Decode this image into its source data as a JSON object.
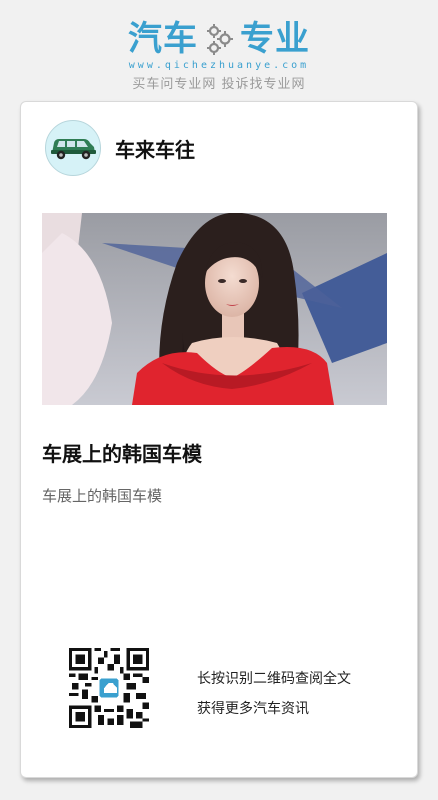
{
  "brand": {
    "logo_left": "汽车",
    "logo_right": "专业",
    "domain": "www.qichezhuanye.com",
    "slogan": "买车问专业网 投诉找专业网",
    "accent_color": "#3aa0cf"
  },
  "card": {
    "author": {
      "name": "车来车往",
      "avatar_icon": "green-car-icon"
    },
    "image_icon": "car-show-model-photo",
    "title": "车展上的韩国车模",
    "summary": "车展上的韩国车模",
    "qr": {
      "icon": "qr-code-icon",
      "line1": "长按识别二维码查阅全文",
      "line2": "获得更多汽车资讯"
    }
  }
}
